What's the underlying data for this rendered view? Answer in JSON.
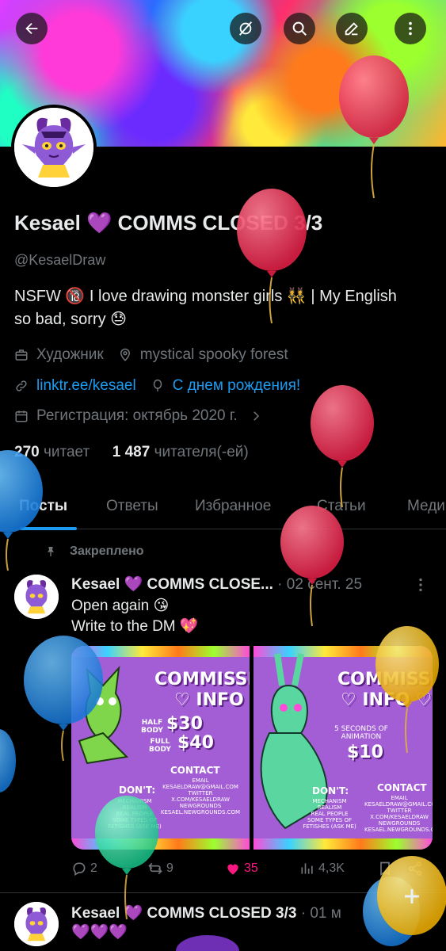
{
  "profile": {
    "name": "Kesael 💜 COMMS CLOSED 3/3",
    "handle": "@KesaelDraw",
    "bio_line1": "NSFW 🔞 I love drawing monster girls 👯‍♀️ | My English",
    "bio_line2": "so bad, sorry 😓",
    "profession": "Художник",
    "location": "mystical spooky forest",
    "website": "linktr.ee/kesael",
    "birthday": "С днем рождения!",
    "joined": "Регистрация: октябрь 2020 г.",
    "following_count": "270",
    "following_label": "читает",
    "followers_count": "1 487",
    "followers_label": "читателя(-ей)"
  },
  "tabs": [
    "Посты",
    "Ответы",
    "Избранное",
    "Статьи",
    "Меди"
  ],
  "pinned_label": "Закреплено",
  "posts": [
    {
      "author": "Kesael 💜 COMMS CLOSE...",
      "date": "· 02 сент. 25",
      "text_line1": "Open again 😘",
      "text_line2": "Write to the DM 💖",
      "replies": "2",
      "reposts": "9",
      "likes": "35",
      "views": "4,3K"
    },
    {
      "author": "Kesael 💜 COMMS CLOSED 3/3",
      "date": "· 01 м",
      "text_line1": "💜💜💜"
    }
  ],
  "media_left": {
    "title1": "COMMISSI",
    "title2": "♡ INFO ♡",
    "half_label": "HALF\nBODY",
    "half_price": "$30",
    "full_label": "FULL\nBODY",
    "full_price": "$40",
    "contact": "CONTACT",
    "contact_lines": "EMAIL\nKESAELDRAW@GMAIL.COM\nTWITTER\nX.COM/KESAELDRAW\nNEWGROUNDS\nKESAEL.NEWGROUNDS.COM",
    "dont": "DON'T:",
    "dont_lines": "MECHANISM\nREALISM\nREAL PEOPLE\nSOME TYPES OF\nFETISHES (ASK ME)"
  },
  "media_right": {
    "title1": "COMMISSI",
    "title2": "♡ INFO ♡",
    "anim_label": "5 SECONDS OF\nANIMATION",
    "anim_price": "$10",
    "contact": "CONTACT",
    "contact_lines": "EMAIL\nKESAELDRAW@GMAIL.COM\nTWITTER\nX.COM/KESAELDRAW\nNEWGROUNDS\nKESAEL.NEWGROUNDS.COM",
    "dont": "DON'T:",
    "dont_lines": "MECHANISM\nREALISM\nREAL PEOPLE\nSOME TYPES OF\nFETISHES (ASK ME)"
  },
  "icons": {
    "back": "back-arrow-icon",
    "grok": "grok-icon",
    "search": "search-icon",
    "edit": "edit-icon",
    "more": "more-vertical-icon"
  },
  "colors": {
    "accent": "#1d9bf0",
    "like": "#f91880",
    "muted": "#71767b",
    "text": "#e7e9ea"
  }
}
